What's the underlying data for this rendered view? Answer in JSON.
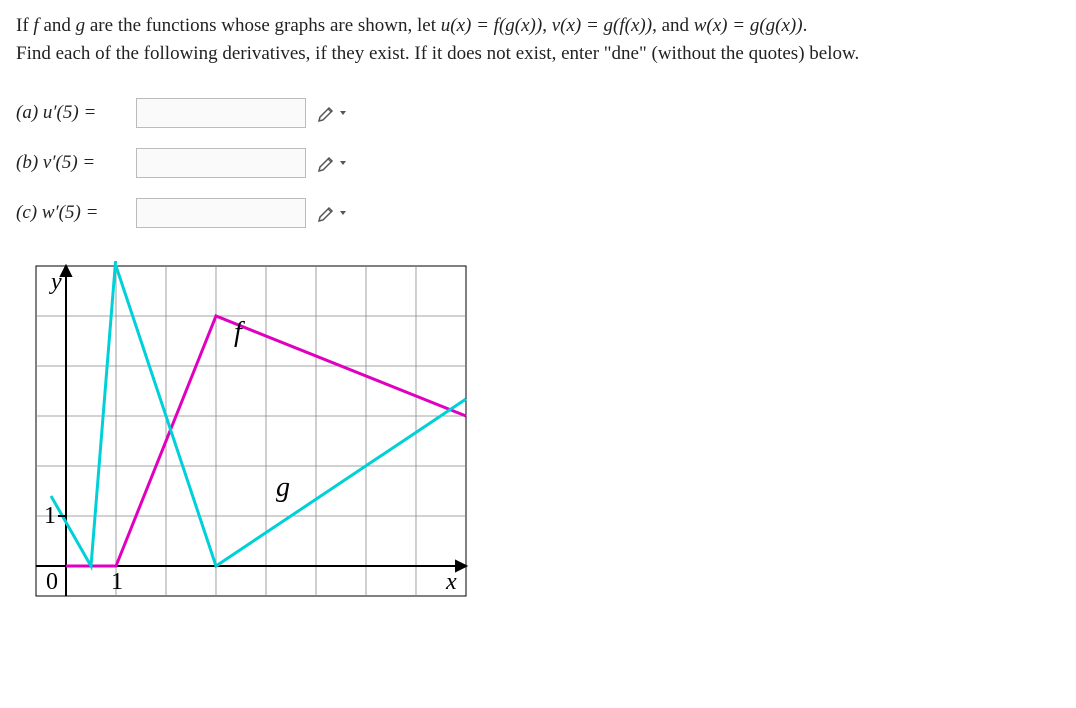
{
  "problem": {
    "line1_pre": "If ",
    "f": "f",
    "and": " and ",
    "g": "g",
    "line1_mid": " are the functions whose graphs are shown, let ",
    "u_def": "u(x) = f(g(x))",
    "comma1": ", ",
    "v_def": "v(x) = g(f(x))",
    "comma2": ", and ",
    "w_def": "w(x) = g(g(x))",
    "period": ".",
    "line2": "Find each of the following derivatives, if they exist. If it does not exist, enter \"dne\" (without the quotes) below."
  },
  "parts": {
    "a_label": "(a) u′(5) =",
    "b_label": "(b) v′(5) =",
    "c_label": "(c) w′(5) =",
    "a_value": "",
    "b_value": "",
    "c_value": ""
  },
  "graph": {
    "xlabel": "x",
    "ylabel": "y",
    "origin_label": "0",
    "one_x": "1",
    "one_y": "1",
    "f_label": "f",
    "g_label": "g"
  },
  "chart_data": {
    "type": "line",
    "xlim": [
      0,
      8
    ],
    "ylim": [
      0,
      6
    ],
    "grid": true,
    "series": [
      {
        "name": "f",
        "color": "#e000c0",
        "points": [
          [
            0,
            0
          ],
          [
            1,
            0
          ],
          [
            3,
            5
          ],
          [
            8,
            3
          ]
        ]
      },
      {
        "name": "g",
        "color": "#00d0d8",
        "points": [
          [
            -0.3,
            1.4
          ],
          [
            0.5,
            0
          ],
          [
            1,
            6.2
          ],
          [
            1,
            6
          ],
          [
            3,
            0
          ],
          [
            8,
            3.33
          ]
        ]
      }
    ],
    "xlabel": "x",
    "ylabel": "y"
  }
}
